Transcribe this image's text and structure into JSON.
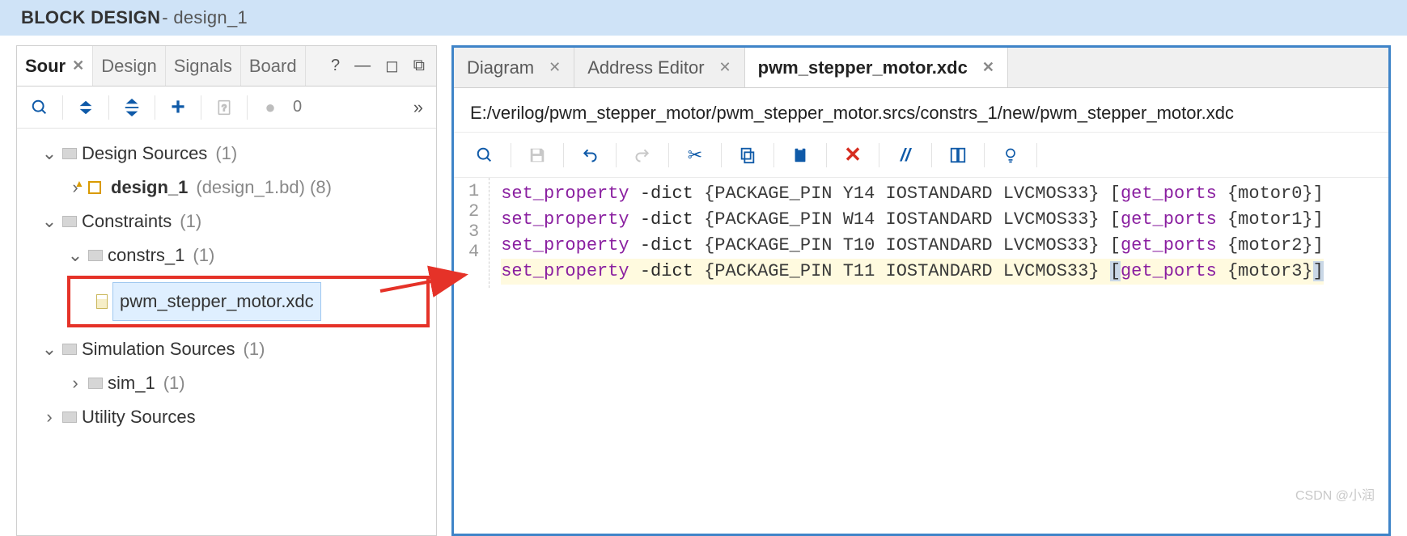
{
  "titlebar": {
    "label_bold": "BLOCK DESIGN",
    "label_suffix": " - design_1"
  },
  "left": {
    "tabs": [
      {
        "label": "Sour",
        "active": true,
        "closable": true
      },
      {
        "label": "Design",
        "active": false
      },
      {
        "label": "Signals",
        "active": false
      },
      {
        "label": "Board",
        "active": false
      }
    ],
    "win_help": "?",
    "toolbar_zero": "0",
    "tree": {
      "design_sources": {
        "label": "Design Sources",
        "count": "(1)"
      },
      "design_1": {
        "label": "design_1",
        "suffix": " (design_1.bd) (8)"
      },
      "constraints": {
        "label": "Constraints",
        "count": "(1)"
      },
      "constrs_1": {
        "label": "constrs_1",
        "count": "(1)"
      },
      "xdc_file": {
        "label": "pwm_stepper_motor.xdc"
      },
      "sim_sources": {
        "label": "Simulation Sources",
        "count": "(1)"
      },
      "sim_1": {
        "label": "sim_1",
        "count": "(1)"
      },
      "utility_sources": {
        "label": "Utility Sources"
      }
    }
  },
  "right": {
    "tabs": [
      {
        "label": "Diagram",
        "active": false
      },
      {
        "label": "Address Editor",
        "active": false
      },
      {
        "label": "pwm_stepper_motor.xdc",
        "active": true
      }
    ],
    "path": "E:/verilog/pwm_stepper_motor/pwm_stepper_motor.srcs/constrs_1/new/pwm_stepper_motor.xdc",
    "code": {
      "kw": "set_property",
      "opt": "-dict",
      "fn": "get_ports",
      "lines": [
        {
          "n": "1",
          "body": "{PACKAGE_PIN Y14 IOSTANDARD LVCMOS33}",
          "port": "{motor0}"
        },
        {
          "n": "2",
          "body": "{PACKAGE_PIN W14 IOSTANDARD LVCMOS33}",
          "port": "{motor1}"
        },
        {
          "n": "3",
          "body": "{PACKAGE_PIN T10 IOSTANDARD LVCMOS33}",
          "port": "{motor2}"
        },
        {
          "n": "4",
          "body": "{PACKAGE_PIN T11 IOSTANDARD LVCMOS33}",
          "port": "{motor3}"
        }
      ]
    }
  },
  "watermark": "CSDN @小润"
}
